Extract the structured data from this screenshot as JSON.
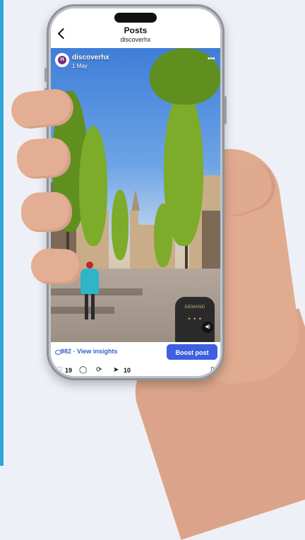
{
  "header": {
    "title": "Posts",
    "subtitle": "discoverhx"
  },
  "post": {
    "account": "discoverhx",
    "date": "1 May",
    "avatar_initial": "H",
    "views": "982",
    "insights_label": "982 · View insights",
    "boost_label": "Boost post",
    "likes": "19",
    "shares": "10",
    "sign_text": "DEMAND",
    "sign_sub": "✦ ✦ ✦"
  },
  "icons": {
    "back": "chevron-left-icon",
    "more": "more-icon",
    "eye": "eye-icon",
    "like": "heart-icon",
    "comment": "comment-icon",
    "repost": "repost-icon",
    "share": "send-icon",
    "save": "bookmark-icon",
    "audio": "audio-icon"
  },
  "colors": {
    "accent": "#3e5fe0",
    "link": "#3561c8",
    "edge_bar": "#2ea7d6"
  }
}
